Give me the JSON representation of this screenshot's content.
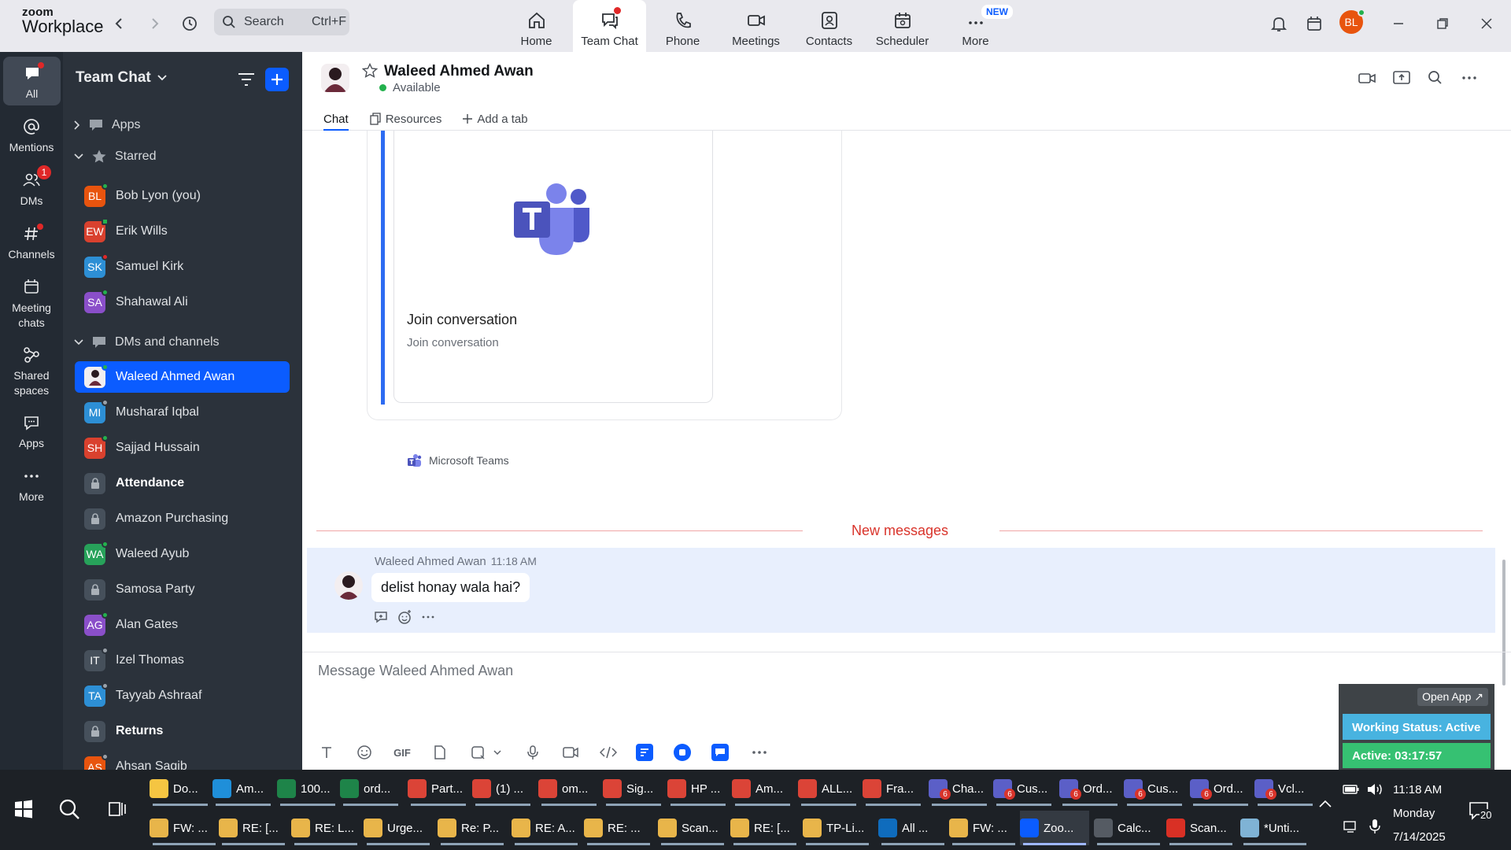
{
  "app": {
    "brand_top": "zoom",
    "brand_bottom": "Workplace"
  },
  "search": {
    "placeholder": "Search",
    "shortcut": "Ctrl+F"
  },
  "nav": {
    "tabs": [
      {
        "label": "Home",
        "icon": "home-icon"
      },
      {
        "label": "Team Chat",
        "icon": "chat-icon",
        "active": true
      },
      {
        "label": "Phone",
        "icon": "phone-icon"
      },
      {
        "label": "Meetings",
        "icon": "video-icon"
      },
      {
        "label": "Contacts",
        "icon": "contacts-icon"
      },
      {
        "label": "Scheduler",
        "icon": "calendar-icon"
      },
      {
        "label": "More",
        "icon": "more-icon",
        "badge": "NEW"
      }
    ]
  },
  "user": {
    "initials": "BL",
    "avatar_color": "#e8540e"
  },
  "rail": {
    "items": [
      {
        "label": "All",
        "icon": "chat-bubble-icon"
      },
      {
        "label": "Mentions",
        "icon": "at-icon"
      },
      {
        "label": "DMs",
        "icon": "people-icon",
        "badge": "1"
      },
      {
        "label": "Channels",
        "icon": "hash-icon"
      },
      {
        "label": "Meeting chats",
        "icon": "calendar-icon"
      },
      {
        "label": "Shared spaces",
        "icon": "shared-icon"
      },
      {
        "label": "Apps",
        "icon": "apps-icon"
      },
      {
        "label": "More",
        "icon": "more-icon"
      }
    ]
  },
  "sidebar": {
    "title": "Team Chat",
    "sections": {
      "apps": "Apps",
      "starred": "Starred",
      "dms": "DMs and channels"
    },
    "starred": [
      {
        "initials": "BL",
        "name": "Bob Lyon (you)",
        "color": "#e8540e"
      },
      {
        "initials": "EW",
        "name": "Erik Wills",
        "color": "#d9412e"
      },
      {
        "initials": "SK",
        "name": "Samuel Kirk",
        "color": "#2d8fd5"
      },
      {
        "initials": "SA",
        "name": "Shahawal Ali",
        "color": "#8a4fc9"
      }
    ],
    "dms": [
      {
        "initials": "",
        "name": "Waleed Ahmed Awan",
        "selected": true
      },
      {
        "initials": "MI",
        "name": "Musharaf Iqbal",
        "color": "#2d8fd5"
      },
      {
        "initials": "SH",
        "name": "Sajjad Hussain",
        "color": "#d9412e"
      },
      {
        "initials": "",
        "name": "Attendance",
        "lock": true,
        "bold": true
      },
      {
        "initials": "",
        "name": "Amazon Purchasing",
        "lock": true
      },
      {
        "initials": "WA",
        "name": "Waleed Ayub",
        "color": "#27a25a"
      },
      {
        "initials": "",
        "name": "Samosa Party",
        "lock": true
      },
      {
        "initials": "AG",
        "name": "Alan Gates",
        "color": "#8a4fc9"
      },
      {
        "initials": "IT",
        "name": "Izel Thomas",
        "color": "#46505b"
      },
      {
        "initials": "TA",
        "name": "Tayyab Ashraaf",
        "color": "#2d8fd5"
      },
      {
        "initials": "",
        "name": "Returns",
        "lock": true,
        "bold": true
      },
      {
        "initials": "AS",
        "name": "Ahsan Saqib",
        "color": "#e8540e"
      }
    ]
  },
  "chat": {
    "name": "Waleed Ahmed Awan",
    "status": "Available",
    "tabs": {
      "chat": "Chat",
      "resources": "Resources",
      "add": "Add a tab"
    },
    "card": {
      "title": "Join conversation",
      "subtitle": "Join conversation",
      "footer": "Microsoft Teams"
    },
    "new_messages": "New messages",
    "message": {
      "sender": "Waleed Ahmed Awan",
      "time": "11:18 AM",
      "text": "delist honay wala hai?"
    },
    "composer_placeholder": "Message Waleed Ahmed Awan",
    "gif_label": "GIF"
  },
  "widget": {
    "open_app": "Open App ↗",
    "working_status": "Working Status: Active",
    "active": "Active: 03:17:57"
  },
  "taskbar": {
    "row1": [
      {
        "label": "Do...",
        "color": "#f5c542"
      },
      {
        "label": "Am...",
        "color": "#1f8fd9"
      },
      {
        "label": "100...",
        "color": "#1e8449"
      },
      {
        "label": "ord...",
        "color": "#1e8449"
      },
      {
        "label": "Part...",
        "color": "#db4437"
      },
      {
        "label": "(1) ...",
        "color": "#db4437"
      },
      {
        "label": "om...",
        "color": "#db4437"
      },
      {
        "label": "Sig...",
        "color": "#db4437"
      },
      {
        "label": "HP ...",
        "color": "#db4437"
      },
      {
        "label": "Am...",
        "color": "#db4437"
      },
      {
        "label": "ALL...",
        "color": "#db4437"
      },
      {
        "label": "Fra...",
        "color": "#db4437"
      },
      {
        "label": "Cha...",
        "color": "#5b5fc7"
      },
      {
        "label": "Cus...",
        "color": "#5b5fc7"
      },
      {
        "label": "Ord...",
        "color": "#5b5fc7"
      },
      {
        "label": "Cus...",
        "color": "#5b5fc7"
      },
      {
        "label": "Ord...",
        "color": "#5b5fc7"
      },
      {
        "label": "Vcl...",
        "color": "#5b5fc7"
      }
    ],
    "row2": [
      {
        "label": "FW: ...",
        "color": "#e8b54a"
      },
      {
        "label": "RE: [...",
        "color": "#e8b54a"
      },
      {
        "label": "RE: L...",
        "color": "#e8b54a"
      },
      {
        "label": "Urge...",
        "color": "#e8b54a"
      },
      {
        "label": "Re: P...",
        "color": "#e8b54a"
      },
      {
        "label": "RE: A...",
        "color": "#e8b54a"
      },
      {
        "label": "RE: ...",
        "color": "#e8b54a"
      },
      {
        "label": "Scan...",
        "color": "#e8b54a"
      },
      {
        "label": "RE: [...",
        "color": "#e8b54a"
      },
      {
        "label": "TP-Li...",
        "color": "#e8b54a"
      },
      {
        "label": "All ...",
        "color": "#0f6cbd"
      },
      {
        "label": "FW: ...",
        "color": "#e8b54a"
      },
      {
        "label": "Zoo...",
        "color": "#0b5cff"
      },
      {
        "label": "Calc...",
        "color": "#555b63"
      },
      {
        "label": "Scan...",
        "color": "#d93025"
      },
      {
        "label": "*Unti...",
        "color": "#7fb3d5"
      }
    ],
    "badge_num": "6",
    "clock": {
      "time": "11:18 AM",
      "day": "Monday",
      "date": "7/14/2025"
    },
    "notif_count": "20"
  }
}
